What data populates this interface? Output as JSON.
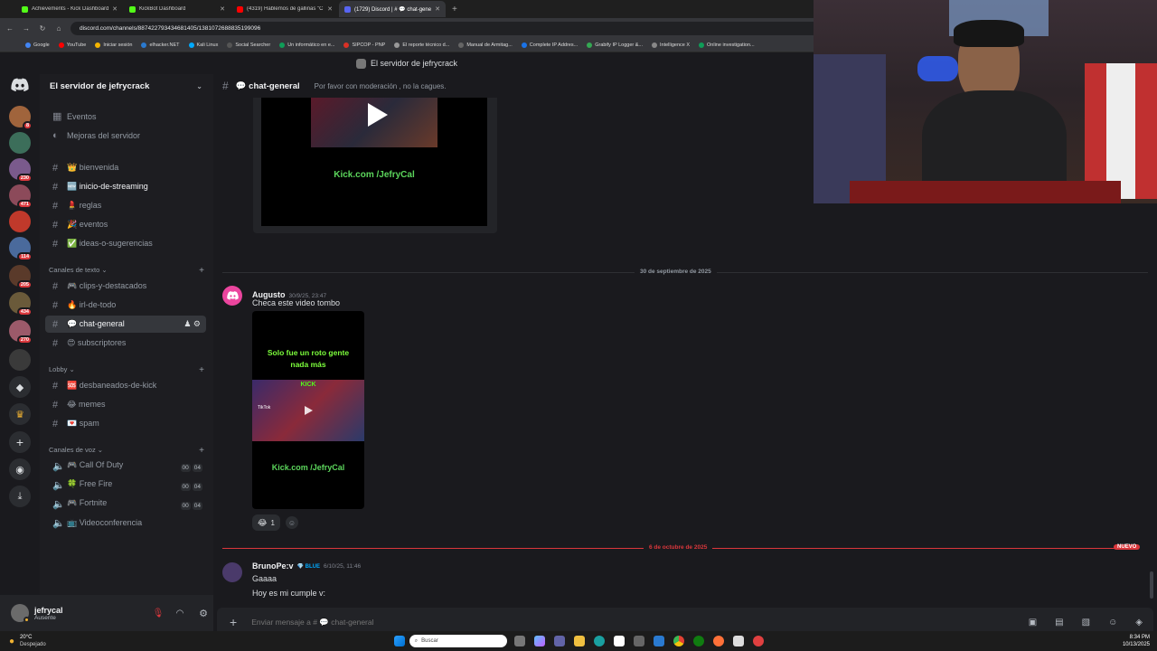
{
  "browser": {
    "tabs": [
      {
        "title": "Achievements - Kick Dashboard",
        "color": "#53fc18"
      },
      {
        "title": "KickBot Dashboard",
        "color": "#53fc18"
      },
      {
        "title": "(4319) Hablemos de gallinas \"C",
        "color": "#ff0000"
      },
      {
        "title": "(1729) Discord | # 💬 chat-gene",
        "color": "#5865f2"
      }
    ],
    "url": "discord.com/channels/887422793434681405/1381072688835199096",
    "bookmarks": [
      "Google",
      "YouTube",
      "Iniciar sesión",
      "elhacker.NET",
      "Kali Linux",
      "Social Searcher",
      "Un informático en e...",
      "SIPCOP - PNP",
      "El reporte técnico d...",
      "Manual de Armitag...",
      "Complete IP Addres...",
      "Grabify IP Logger &...",
      "Intelligence X",
      "Online investigation..."
    ]
  },
  "app": {
    "window_title": "El servidor de jefrycrack",
    "server_name": "El servidor de jefrycrack",
    "badges": [
      "8",
      "230",
      "471",
      "114",
      "205",
      "434",
      "270"
    ],
    "top_items": [
      {
        "icon": "calendar-icon",
        "label": "Eventos"
      },
      {
        "icon": "pin-icon",
        "label": "Mejoras del servidor"
      }
    ],
    "info_channels": [
      "👑 bienvenida",
      "🆕 inicio-de-streaming",
      "💄 reglas",
      "🎉 eventos",
      "✅ ideas-o-sugerencias"
    ],
    "cat_text": "Canales de texto",
    "text_channels": [
      "🎮 clips-y-destacados",
      "🔥 irl-de-todo",
      "💬 chat-general",
      "😍 subscriptores"
    ],
    "cat_lobby": "Lobby",
    "lobby_channels": [
      "🆘 desbaneados-de-kick",
      "😂 memes",
      "💌 spam"
    ],
    "cat_voice": "Canales de voz",
    "voice_channels": [
      {
        "name": "🎮 Call Of Duty",
        "a": "00",
        "b": "04"
      },
      {
        "name": "🍀 Free Fire",
        "a": "00",
        "b": "04"
      },
      {
        "name": "🎮 Fortnite",
        "a": "00",
        "b": "04"
      },
      {
        "name": "📺 Videoconferencia"
      }
    ],
    "user": {
      "name": "jefrycal",
      "status": "Ausente"
    }
  },
  "chat": {
    "channel": "💬 chat-general",
    "topic": "Por favor con moderación , no la cagues.",
    "video1_caption": "Kick.com /JefryCal",
    "date1": "30 de septiembre de 2025",
    "msg1": {
      "author": "Augusto",
      "time": "30/9/25, 23:47",
      "text": "Checa este video tombo"
    },
    "video2_overlay": "Solo fue un roto gente nada más",
    "video2_kick": "KICK",
    "video2_tiktok": "TikTok",
    "video2_caption": "Kick.com /JefryCal",
    "reaction": {
      "emoji": "😂",
      "count": "1"
    },
    "date2": "6 de octubre de 2025",
    "new_label": "NUEVO",
    "msg2": {
      "author": "BrunoPe:v",
      "tag": "BLUE",
      "time": "6/10/25, 11:46",
      "lines": [
        "Gaaaa",
        "Hoy es mi cumple v:"
      ]
    },
    "placeholder": "Enviar mensaje a # 💬 chat-general"
  },
  "taskbar": {
    "weather_temp": "20°C",
    "weather_desc": "Despejado",
    "search": "Buscar",
    "time": "8:34 PM",
    "date": "10/13/2025"
  }
}
